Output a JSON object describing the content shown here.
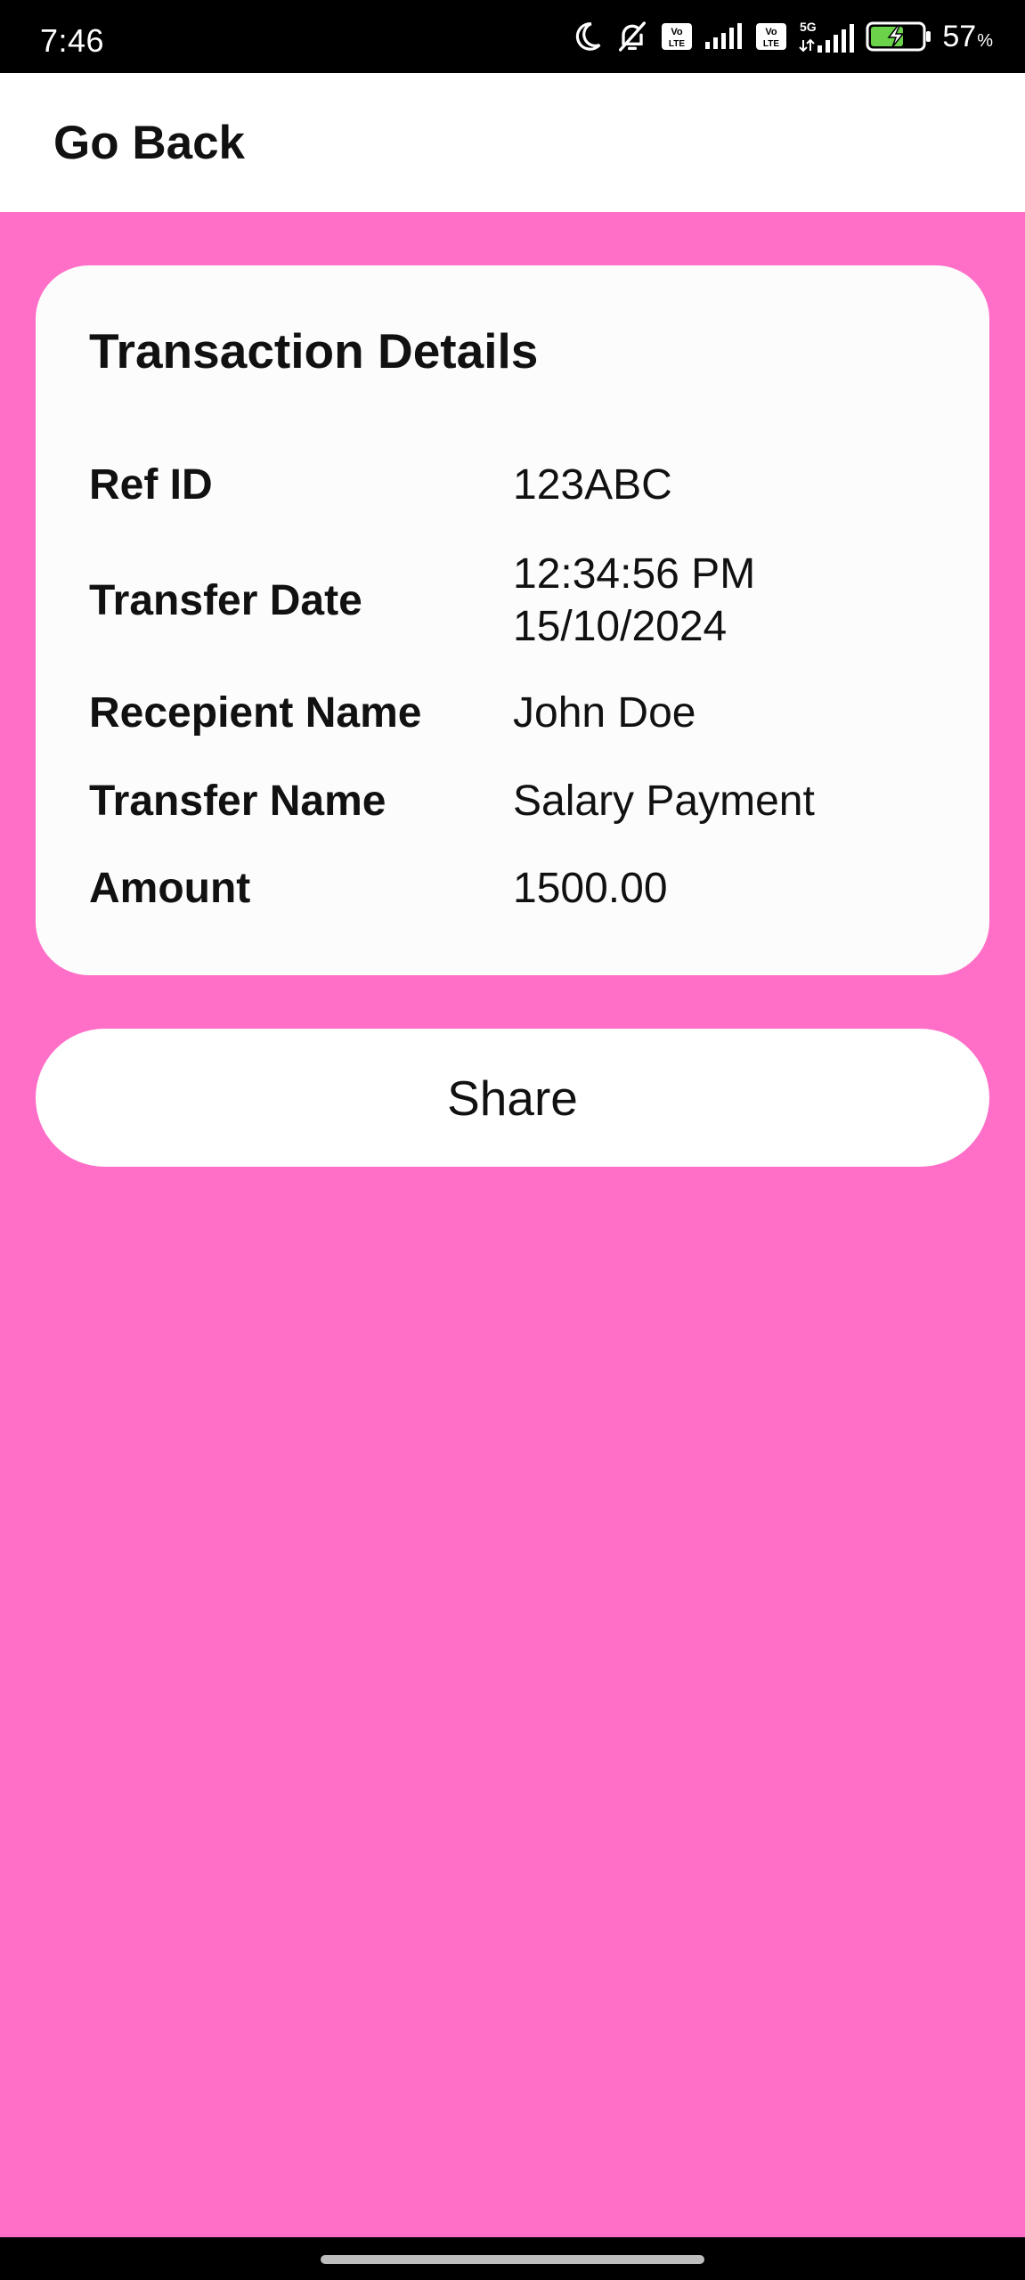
{
  "status_bar": {
    "time": "7:46",
    "battery_value": "57",
    "battery_unit": "%",
    "network_1": "VoLTE",
    "network_2": "VoLTE",
    "network_3": "5G",
    "icons": [
      "moon-icon",
      "bell-off-icon",
      "volte-icon",
      "signal-icon",
      "volte-icon",
      "5g-signal-icon",
      "battery-charging-icon"
    ]
  },
  "header": {
    "back_label": "Go Back"
  },
  "card": {
    "title": "Transaction Details",
    "rows": [
      {
        "label": "Ref ID",
        "value": "123ABC"
      },
      {
        "label": "Transfer Date",
        "value_line1": "12:34:56 PM",
        "value_line2": "15/10/2024"
      },
      {
        "label": "Recepient Name",
        "value": "John Doe"
      },
      {
        "label": "Transfer Name",
        "value": "Salary Payment"
      },
      {
        "label": "Amount",
        "value": "1500.00"
      }
    ]
  },
  "share_button": {
    "label": "Share"
  },
  "colors": {
    "background": "#ff6fc8",
    "card": "#fcfcfc",
    "text": "#111111",
    "battery_fill": "#6ad34a"
  }
}
